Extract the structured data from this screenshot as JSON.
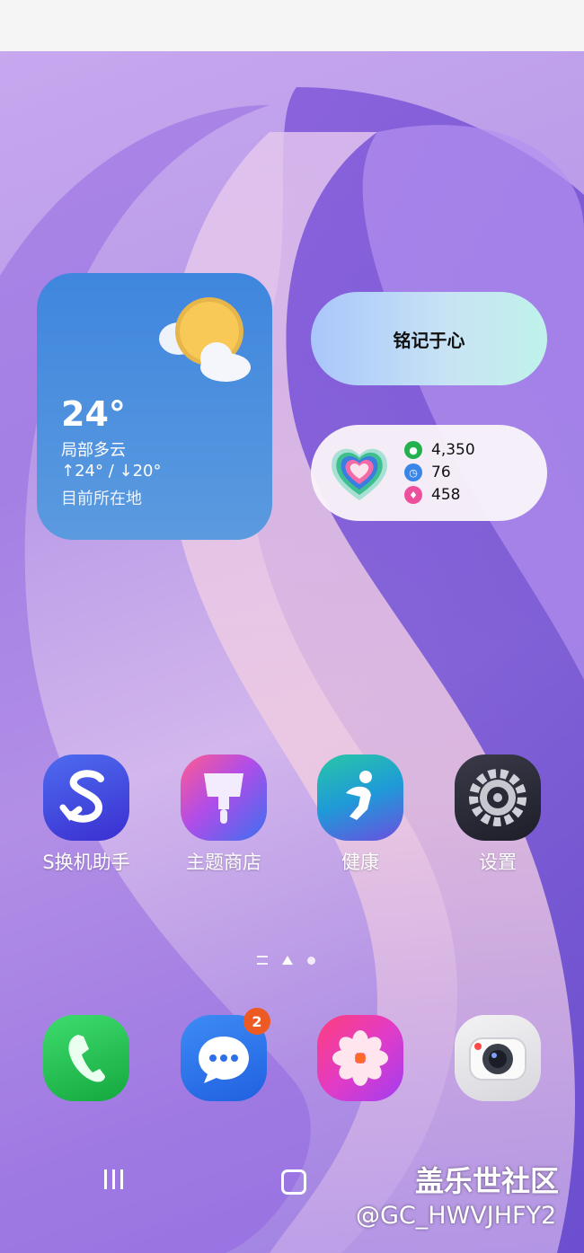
{
  "weather": {
    "temperature": "24°",
    "condition": "局部多云",
    "high_low": "↑24° / ↓20°",
    "location": "目前所在地",
    "icon": "partly-cloudy-icon"
  },
  "pill_widget": {
    "text": "铭记于心"
  },
  "health": {
    "steps": "4,350",
    "active_minutes": "76",
    "calories": "458",
    "colors": {
      "steps": "#22b14c",
      "minutes": "#3a86e8",
      "calories": "#ee4f9c"
    }
  },
  "apps": [
    {
      "label": "S换机助手",
      "icon": "smart-switch-icon"
    },
    {
      "label": "主题商店",
      "icon": "theme-store-icon"
    },
    {
      "label": "健康",
      "icon": "health-icon"
    },
    {
      "label": "设置",
      "icon": "settings-icon"
    }
  ],
  "dock": {
    "messages_badge": "2",
    "items": [
      "phone-icon",
      "messages-icon",
      "gallery-icon",
      "camera-icon"
    ]
  },
  "watermark": {
    "site": "盖乐世社区",
    "user": "@GC_HWVJHFY2"
  }
}
